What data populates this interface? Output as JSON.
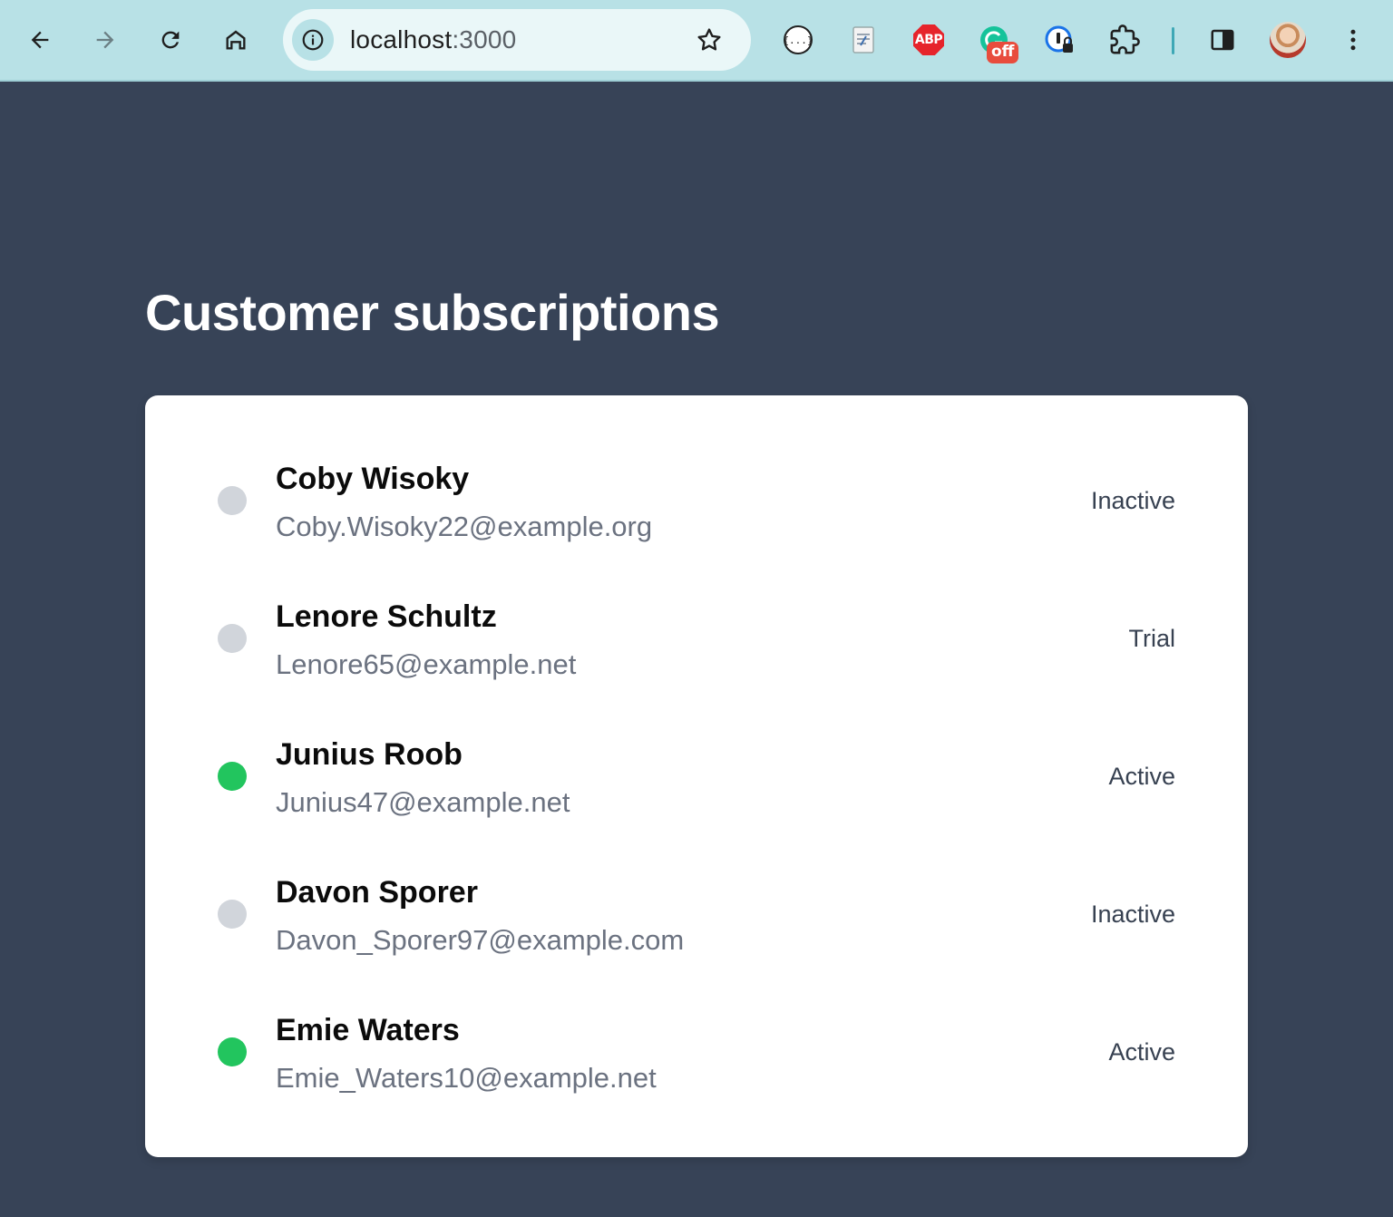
{
  "browser": {
    "url_host": "localhost",
    "url_port": ":3000",
    "icons": {
      "back": "arrow-left-icon",
      "forward": "arrow-right-icon",
      "reload": "reload-icon",
      "home": "home-icon",
      "site_info": "info-icon",
      "bookmark": "star-icon",
      "extensions": [
        "json-viewer-icon",
        "script-icon",
        "adblock-icon",
        "grammarly-icon",
        "password-manager-icon",
        "puzzle-icon"
      ],
      "side_panel": "side-panel-icon",
      "menu": "more-vert-icon"
    },
    "adblock_label": "ABP",
    "grammarly_badge": "off",
    "accent_color": "#b8e1e6"
  },
  "page": {
    "title": "Customer subscriptions",
    "background_color": "#374357"
  },
  "subscriptions": [
    {
      "name": "Coby Wisoky",
      "email": "Coby.Wisoky22@example.org",
      "status": "Inactive",
      "dot_color": "#d1d5db"
    },
    {
      "name": "Lenore Schultz",
      "email": "Lenore65@example.net",
      "status": "Trial",
      "dot_color": "#d1d5db"
    },
    {
      "name": "Junius Roob",
      "email": "Junius47@example.net",
      "status": "Active",
      "dot_color": "#22c55e"
    },
    {
      "name": "Davon Sporer",
      "email": "Davon_Sporer97@example.com",
      "status": "Inactive",
      "dot_color": "#d1d5db"
    },
    {
      "name": "Emie Waters",
      "email": "Emie_Waters10@example.net",
      "status": "Active",
      "dot_color": "#22c55e"
    }
  ]
}
